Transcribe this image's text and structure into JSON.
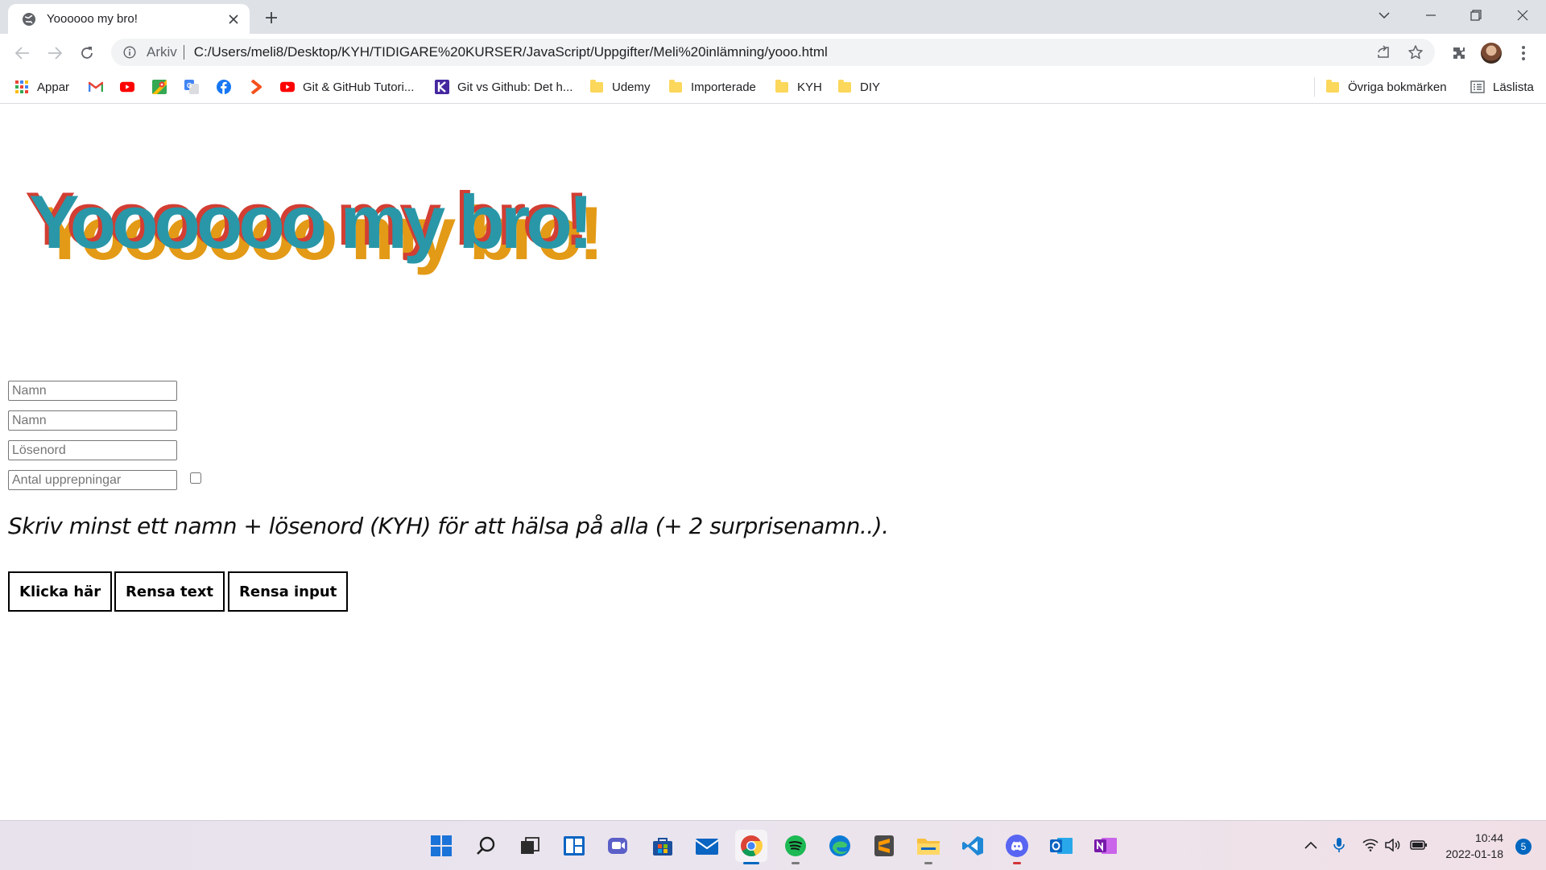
{
  "browser": {
    "tab_title": "Yoooooo my bro!",
    "omnibox_scheme": "Arkiv",
    "url": "C:/Users/meli8/Desktop/KYH/TIDIGARE%20KURSER/JavaScript/Uppgifter/Meli%20inlämning/yooo.html"
  },
  "bookmarks": {
    "apps_label": "Appar",
    "items": [
      {
        "label": "Git & GitHub Tutori...",
        "icon": "youtube-icon"
      },
      {
        "label": "Git vs Github: Det h...",
        "icon": "k-icon"
      },
      {
        "label": "Udemy",
        "icon": "folder-icon"
      },
      {
        "label": "Importerade",
        "icon": "folder-icon"
      },
      {
        "label": "KYH",
        "icon": "folder-icon"
      },
      {
        "label": "DIY",
        "icon": "folder-icon"
      }
    ],
    "other_label": "Övriga bokmärken",
    "reading_list_label": "Läslista"
  },
  "page": {
    "headline": "Yoooooo my bro!",
    "inputs": {
      "name1_placeholder": "Namn",
      "name2_placeholder": "Namn",
      "password_placeholder": "Lösenord",
      "repeat_placeholder": "Antal upprepningar"
    },
    "instruction": "Skriv minst ett namn + lösenord (KYH) för att hälsa på alla (+ 2 surprisenamn..).",
    "buttons": {
      "click": "Klicka här",
      "clear_text": "Rensa text",
      "clear_input": "Rensa input"
    }
  },
  "taskbar": {
    "time": "10:44",
    "date": "2022-01-18",
    "notification_count": "5"
  },
  "colors": {
    "headline_main": "#2997a8",
    "headline_shadow_red": "#d23e33",
    "headline_shadow_orange": "#e39a16",
    "accent": "#0067c0"
  }
}
